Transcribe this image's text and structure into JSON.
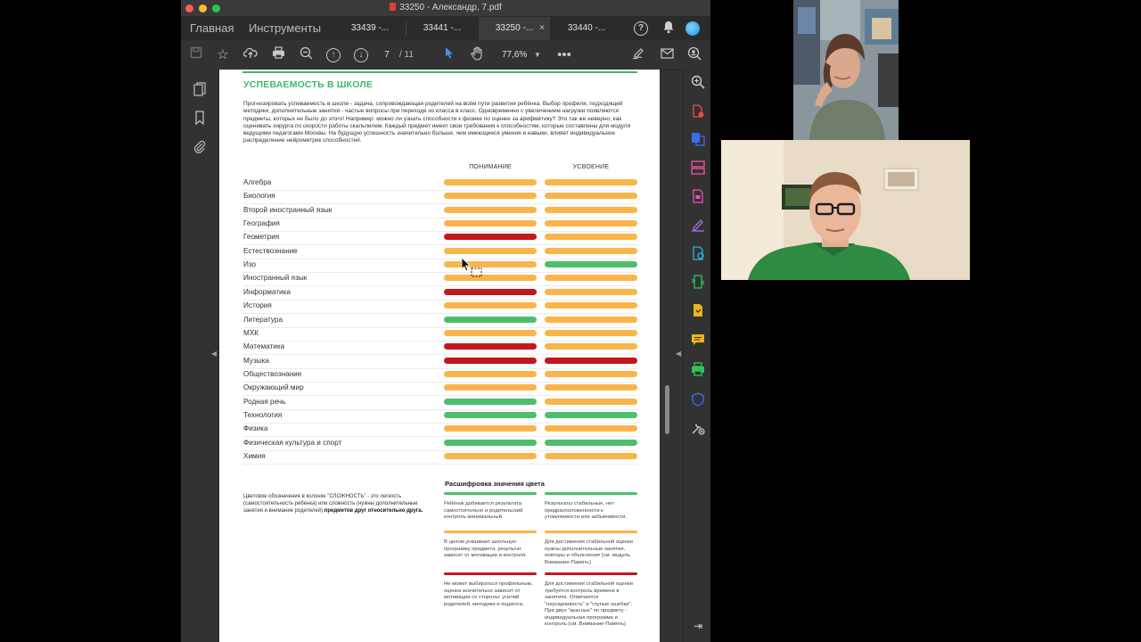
{
  "window": {
    "title": "33250 - Александр, 7.pdf"
  },
  "nav": {
    "home": "Главная",
    "tools": "Инструменты"
  },
  "tabs": [
    {
      "label": "33439 -...",
      "active": false
    },
    {
      "label": "33441 -...",
      "active": false
    },
    {
      "label": "33250 -...",
      "active": true
    },
    {
      "label": "33440 -...",
      "active": false
    }
  ],
  "tab_close": "×",
  "toolbar": {
    "current_page": "7",
    "total_pages": "/ 11",
    "zoom": "77,6%"
  },
  "document": {
    "heading": "УСПЕВАЕМОСТЬ В ШКОЛЕ",
    "intro": "Прогнозировать успеваемость в школе - задача, сопровождающая родителей на всём пути развития ребёнка. Выбор профиля, подходящей методики, дополнительные занятия - частые вопросы при переходе из класса в класс. Одновременно с увеличением нагрузки появляются предметы, которых не было до этого! Например: можно ли узнать способности к физике по оценке за арифметику? Это так же неверно, как оценивать хирурга по скорости работы скальпелем. Каждый предмет имеет свои требования к способностям, которые составлены для модуля ведущими педагогами Москвы. На будущую успешность значительно больше, чем имеющиеся умения и навыки, влияет индивидуальное распределение нейрометрик способностей.",
    "col_understanding": "ПОНИМАНИЕ",
    "col_mastery": "УСВОЕНИЕ",
    "subjects": [
      {
        "name": "Алгебра",
        "understanding": "orange",
        "mastery": "orange"
      },
      {
        "name": "Биология",
        "understanding": "orange",
        "mastery": "orange"
      },
      {
        "name": "Второй иностранный язык",
        "understanding": "orange",
        "mastery": "orange"
      },
      {
        "name": "География",
        "understanding": "orange",
        "mastery": "orange"
      },
      {
        "name": "Геометрия",
        "understanding": "red",
        "mastery": "orange"
      },
      {
        "name": "Естествознание",
        "understanding": "orange",
        "mastery": "orange"
      },
      {
        "name": "Изо",
        "understanding": "orange",
        "mastery": "green"
      },
      {
        "name": "Иностранный язык",
        "understanding": "orange",
        "mastery": "orange"
      },
      {
        "name": "Информатика",
        "understanding": "red",
        "mastery": "orange"
      },
      {
        "name": "История",
        "understanding": "orange",
        "mastery": "orange"
      },
      {
        "name": "Литература",
        "understanding": "green",
        "mastery": "orange"
      },
      {
        "name": "МХК",
        "understanding": "orange",
        "mastery": "orange"
      },
      {
        "name": "Математика",
        "understanding": "red",
        "mastery": "orange"
      },
      {
        "name": "Музыка",
        "understanding": "red",
        "mastery": "red"
      },
      {
        "name": "Обществознание",
        "understanding": "orange",
        "mastery": "orange"
      },
      {
        "name": "Окружающий мир",
        "understanding": "orange",
        "mastery": "orange"
      },
      {
        "name": "Родная речь",
        "understanding": "green",
        "mastery": "orange"
      },
      {
        "name": "Технология",
        "understanding": "green",
        "mastery": "green"
      },
      {
        "name": "Физика",
        "understanding": "orange",
        "mastery": "orange"
      },
      {
        "name": "Физическая культура и спорт",
        "understanding": "green",
        "mastery": "green"
      },
      {
        "name": "Химия",
        "understanding": "orange",
        "mastery": "orange"
      }
    ],
    "decode_title": "Расшифровка значения цвета",
    "note_text": "Цветовое обозначение в колонке \"СЛОЖНОСТЬ\" - это легкость (самостоятельность ребенка) или сложность (нужны дополнительные занятия и внимание родителей) ",
    "note_bold": "предметов друг относительно друга.",
    "legend": [
      {
        "color": "green",
        "understanding": "Ребёнок добивается результата самостоятельно и родительский контроль минимальный.",
        "mastery": "Результаты стабильные, нет предрасположенности к утомляемости или забывчивости."
      },
      {
        "color": "orange",
        "understanding": "В целом усваивает школьную программу предмета, результат зависит от мотивации и контроля.",
        "mastery": "Для достижения стабильной оценки нужны дополнительные занятия, повторы и объяснения (см. модуль Внимание-Память)"
      },
      {
        "color": "red",
        "understanding": "Не может выбираться профильным, оценка значительно зависит от мотивации со стороны: усилий родителей, методики и педагога.",
        "mastery": "Для достижения стабильной оценки требуется контроль времени в занятиях. Отмечается \"неусидчивость\" и \"глупые ошибки\". При двух \"красных\" по предмету - индивидуальная программа и контроль (см. Внимание-Память)."
      }
    ]
  },
  "colors": {
    "green": "#4cbe6c",
    "orange": "#f9b54a",
    "red": "#c4161c",
    "heading_green": "#3fb866"
  },
  "icons": {
    "toolbar": [
      "save-icon",
      "bookmark-star-icon",
      "upload-icon",
      "print-icon",
      "zoom-out-icon",
      "prev-page-icon",
      "next-page-icon",
      "select-cursor-icon",
      "hand-icon",
      "more-icon",
      "sign-icon",
      "mail-icon",
      "search-person-icon"
    ],
    "left_panel": [
      "pages-icon",
      "bookmark-icon",
      "attachment-icon"
    ],
    "right_panel": [
      "zoom-search-icon",
      "create-pdf-icon",
      "export-icon",
      "organize-icon",
      "edit-pdf-icon",
      "fill-sign-icon",
      "enhance-icon",
      "compress-icon",
      "request-icon",
      "comment-icon",
      "print-production-icon",
      "protect-icon",
      "more-tools-icon"
    ]
  }
}
